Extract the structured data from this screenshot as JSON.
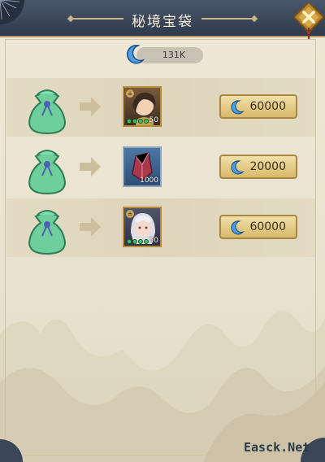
{
  "window": {
    "title": "秘境宝袋"
  },
  "currency": {
    "icon": "crescent-moon-icon",
    "balance": "131K"
  },
  "rows": [
    {
      "bag_icon": "green-pouch-icon",
      "item": {
        "type": "hero-card",
        "icon": "heroine-portrait-icon",
        "badge": "±",
        "level": "50"
      },
      "price": "60000"
    },
    {
      "bag_icon": "green-pouch-icon",
      "item": {
        "type": "material",
        "icon": "red-crystal-icon",
        "count": "1000"
      },
      "price": "20000"
    },
    {
      "bag_icon": "green-pouch-icon",
      "item": {
        "type": "hero-card",
        "icon": "white-hair-heroine-icon",
        "badge": "±",
        "level": "50"
      },
      "price": "60000"
    }
  ],
  "watermark": "Easck.Net",
  "colors": {
    "titlebar": "#3b4759",
    "accent_gold": "#d7b96b",
    "panel": "#ebe4d1",
    "moon": "#5aa7e6"
  }
}
